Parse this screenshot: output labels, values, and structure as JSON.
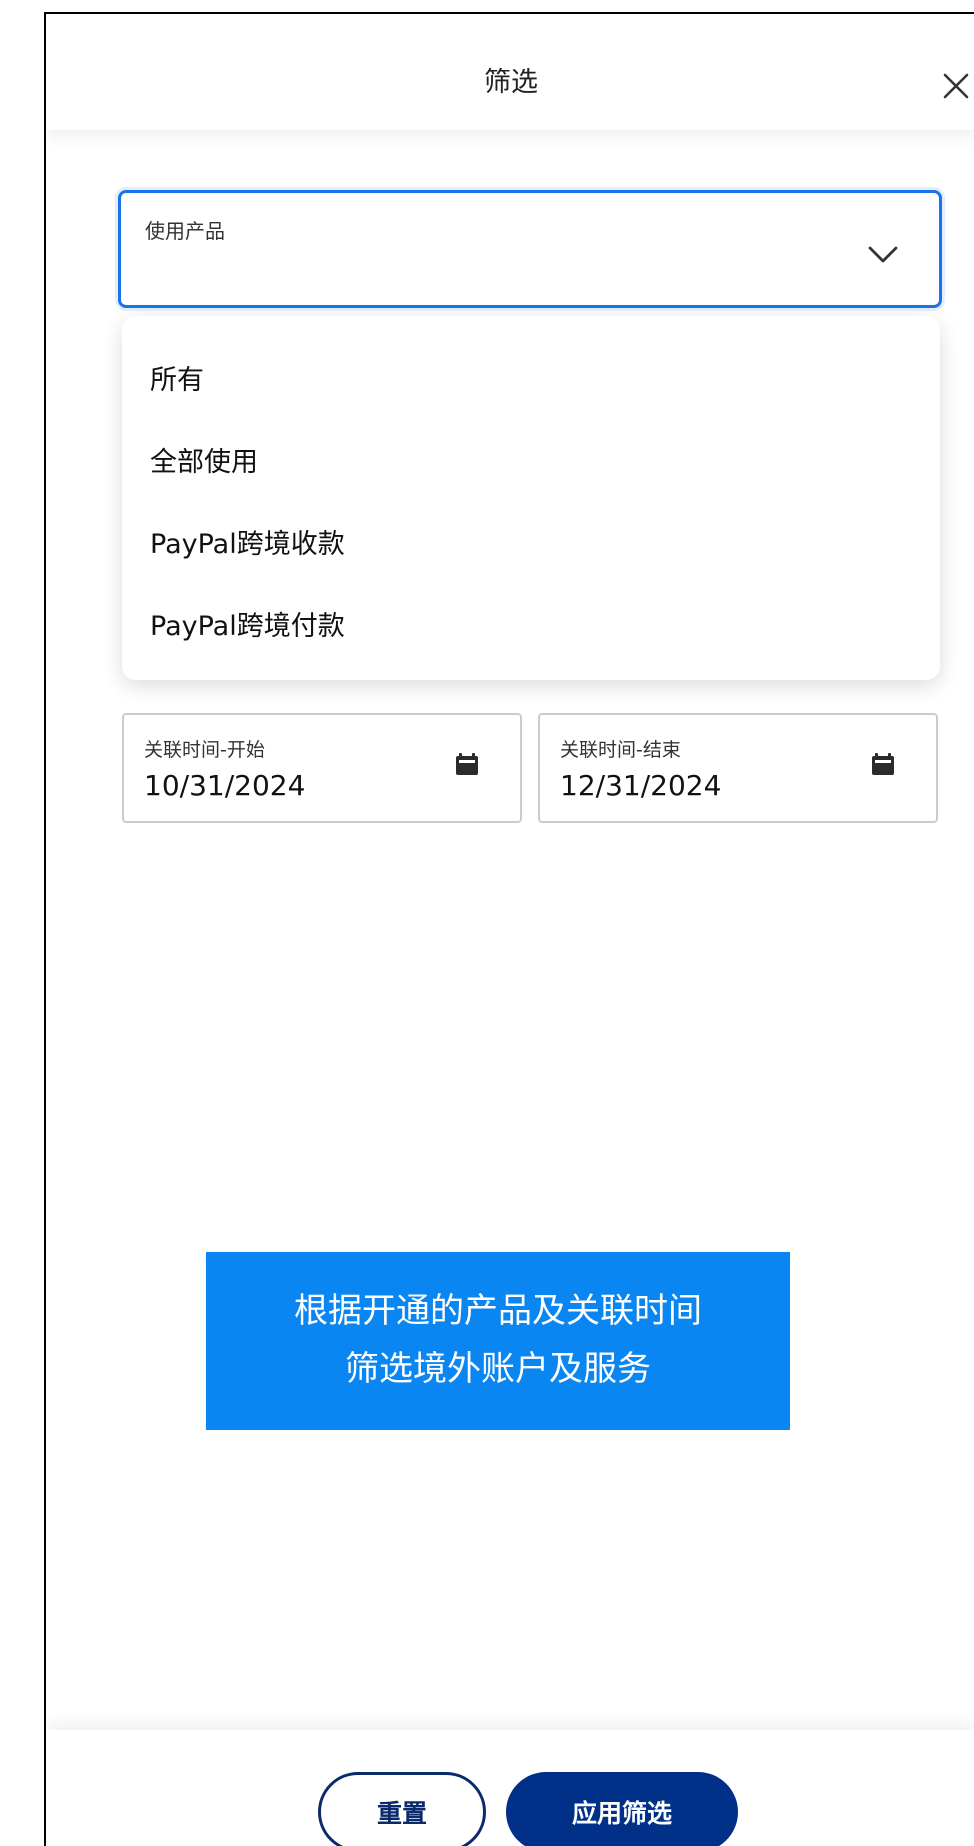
{
  "header": {
    "title": "筛选",
    "close_icon": "close-icon"
  },
  "product_select": {
    "label": "使用产品",
    "value": "",
    "icon": "chevron-down-icon",
    "focus_color": "#1a73e8"
  },
  "dropdown": {
    "options": [
      "所有",
      "全部使用",
      "PayPal跨境收款",
      "PayPal跨境付款"
    ]
  },
  "date_start": {
    "label": "关联时间-开始",
    "value": "10/31/2024",
    "icon": "calendar-icon"
  },
  "date_end": {
    "label": "关联时间-结束",
    "value": "12/31/2024",
    "icon": "calendar-icon"
  },
  "banner": {
    "line1": "根据开通的产品及关联时间",
    "line2": "筛选境外账户及服务",
    "color": "#0a86f2"
  },
  "footer": {
    "reset_label": "重置",
    "apply_label": "应用筛选",
    "primary_color": "#003087"
  }
}
